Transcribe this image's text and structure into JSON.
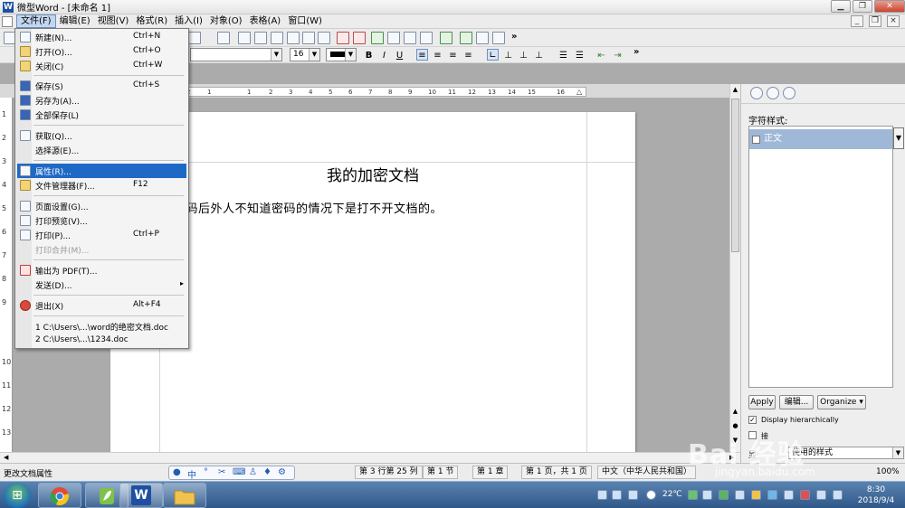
{
  "window": {
    "title": "微型Word - [未命名 1]",
    "app_icon": "W",
    "btn_min": "▁",
    "btn_max": "❐",
    "btn_close": "✕",
    "mdi_min": "_",
    "mdi_max": "❐",
    "mdi_close": "×"
  },
  "menubar": {
    "items": [
      "文件(F)",
      "编辑(E)",
      "视图(V)",
      "格式(R)",
      "插入(I)",
      "对象(O)",
      "表格(A)",
      "窗口(W)"
    ],
    "active_index": 0
  },
  "format_bar": {
    "font_size": "16",
    "bold": "B",
    "italic": "I",
    "underline": "U"
  },
  "toolbar": {
    "more": "»"
  },
  "document": {
    "title": "我的加密文档",
    "body": "密码后外人不知道密码的情况下是打不开文档的。"
  },
  "ruler": {
    "labels": [
      "2",
      "1",
      "1",
      "2",
      "3",
      "4",
      "5",
      "6",
      "7",
      "8",
      "9",
      "10",
      "11",
      "12",
      "13",
      "14",
      "15",
      "16"
    ],
    "vertical_labels": [
      "1",
      "2",
      "3",
      "4",
      "5",
      "6",
      "7",
      "8",
      "9",
      "10",
      "11",
      "12",
      "13"
    ]
  },
  "file_menu": {
    "items": [
      {
        "label": "新建(N)...",
        "shortcut": "Ctrl+N",
        "icon": "new-doc-icon"
      },
      {
        "label": "打开(O)...",
        "shortcut": "Ctrl+O",
        "icon": "open-folder-icon"
      },
      {
        "label": "关闭(C)",
        "shortcut": "Ctrl+W",
        "icon": "close-doc-icon"
      },
      {
        "label": "保存(S)",
        "shortcut": "Ctrl+S",
        "icon": "save-icon"
      },
      {
        "label": "另存为(A)...",
        "shortcut": "",
        "icon": "save-as-icon"
      },
      {
        "label": "全部保存(L)",
        "shortcut": "",
        "icon": "save-all-icon"
      },
      {
        "label": "获取(Q)...",
        "shortcut": "",
        "icon": "scanner-icon"
      },
      {
        "label": "选择源(E)...",
        "shortcut": "",
        "icon": ""
      },
      {
        "label": "属性(R)...",
        "shortcut": "",
        "icon": "properties-icon"
      },
      {
        "label": "文件管理器(F)...",
        "shortcut": "F12",
        "icon": "file-manager-icon"
      },
      {
        "label": "页面设置(G)...",
        "shortcut": "",
        "icon": "page-setup-icon"
      },
      {
        "label": "打印预览(V)...",
        "shortcut": "",
        "icon": "print-preview-icon"
      },
      {
        "label": "打印(P)...",
        "shortcut": "Ctrl+P",
        "icon": "printer-icon"
      },
      {
        "label": "打印合并(M)...",
        "shortcut": "",
        "icon": ""
      },
      {
        "label": "输出为 PDF(T)...",
        "shortcut": "",
        "icon": "pdf-icon"
      },
      {
        "label": "发送(D)...",
        "shortcut": "",
        "icon": "",
        "submenu_arrow": "▸"
      },
      {
        "label": "退出(X)",
        "shortcut": "Alt+F4",
        "icon": "exit-icon"
      },
      {
        "label": "1 C:\\Users\\...\\word的绝密文档.doc",
        "shortcut": "",
        "icon": ""
      },
      {
        "label": "2 C:\\Users\\...\\1234.doc",
        "shortcut": "",
        "icon": ""
      }
    ],
    "highlighted_index": 8,
    "disabled_index": 13
  },
  "task_pane": {
    "label": "字符样式:",
    "style_item": "正文",
    "apply": "Apply",
    "edit": "编辑...",
    "organize": "Organize ▾",
    "display_hierarchically": "Display hierarchically",
    "check_mark": "✓",
    "option2": "接",
    "dropdown_label": "显",
    "dropdown_value": "使用的样式"
  },
  "statusbar": {
    "left_text": "更改文档属性",
    "line_col": "第 3 行第 25 列",
    "section": "第 1 节",
    "chapter": "第 1 章",
    "page": "第 1 页，共 1 页",
    "language": "中文（中华人民共和国）",
    "zoom": "100%",
    "ime_mode": "中"
  },
  "taskbar": {
    "start": "⊞",
    "word_app": "W",
    "temperature": "22℃",
    "time": "8:30",
    "date": "2018/9/4"
  },
  "watermark": {
    "brand": "Bai 经验",
    "url": "jingyan.baidu.com"
  },
  "colors": {
    "menu_highlight": "#1f69c6",
    "style_highlight": "#9fb8d8",
    "taskbar": "#2f5889"
  }
}
